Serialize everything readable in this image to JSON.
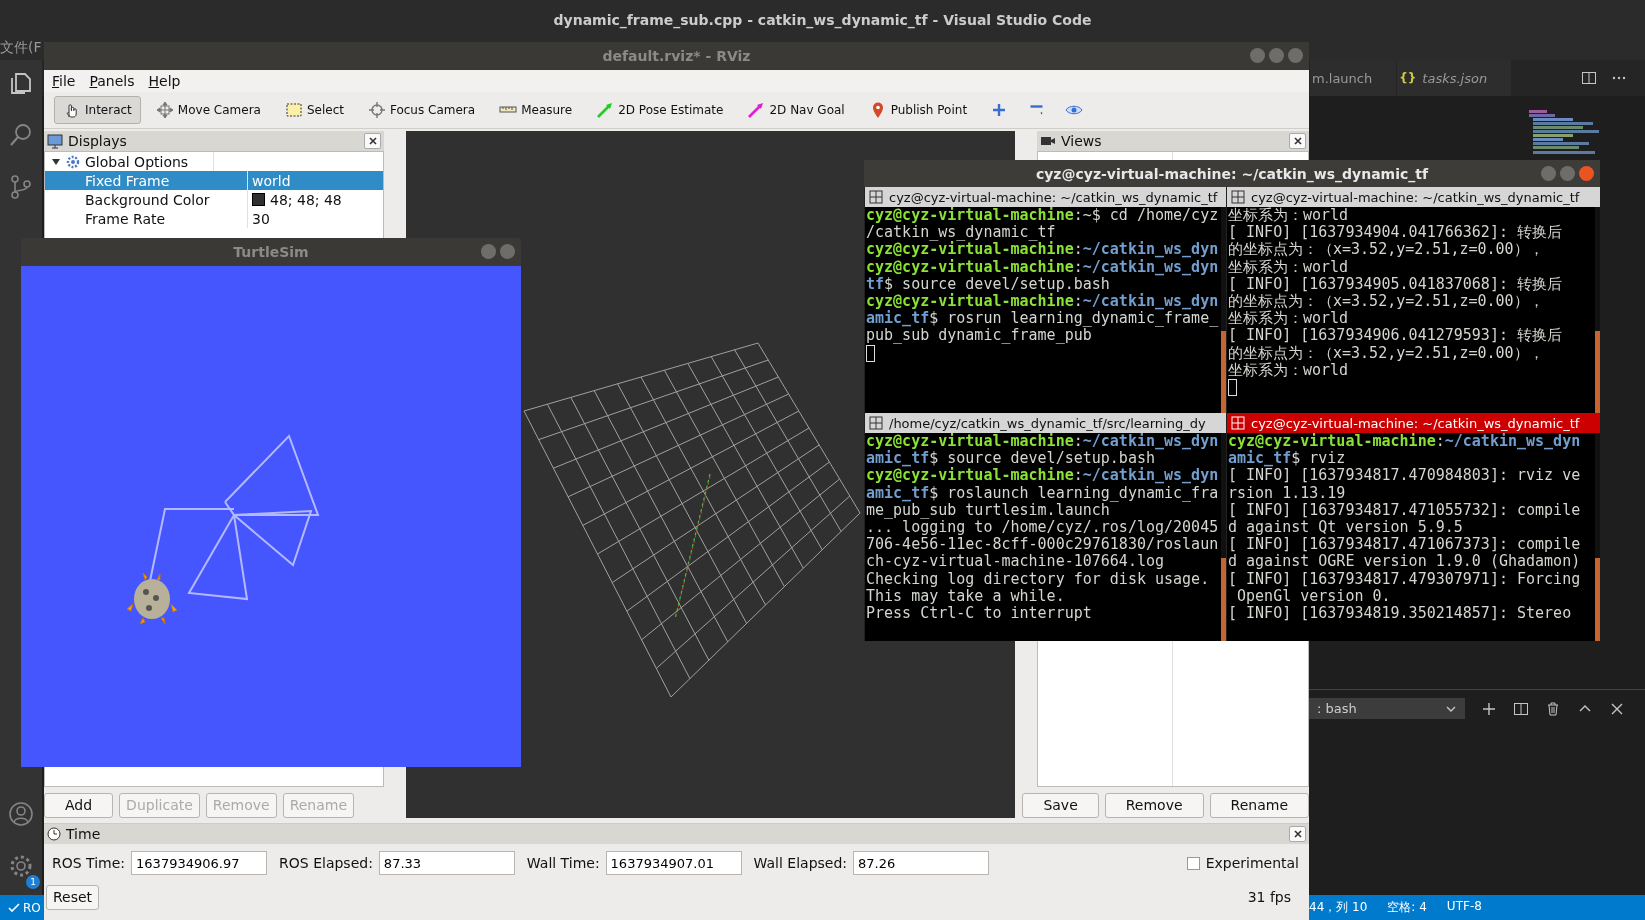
{
  "vscode": {
    "title": "dynamic_frame_sub.cpp - catkin_ws_dynamic_tf - Visual Studio Code",
    "menu_fragment": "文件(F",
    "tabs": [
      {
        "label": "m.launch",
        "kind": "plain"
      },
      {
        "label": "tasks.json",
        "kind": "preview",
        "glyph": "{}"
      }
    ],
    "terminal_dropdown": ": bash",
    "settings_badge": "1",
    "status_left": "RO",
    "status_right": [
      "44，列 10",
      "空格: 4",
      "UTF-8"
    ]
  },
  "rviz": {
    "title": "default.rviz* - RViz",
    "menu": [
      "File",
      "Panels",
      "Help"
    ],
    "tools": [
      {
        "label": "Interact",
        "kind": "hand",
        "selected": true
      },
      {
        "label": "Move Camera",
        "kind": "move",
        "selected": false
      },
      {
        "label": "Select",
        "kind": "select",
        "selected": false
      },
      {
        "label": "Focus Camera",
        "kind": "focus",
        "selected": false
      },
      {
        "label": "Measure",
        "kind": "ruler",
        "selected": false
      },
      {
        "label": "2D Pose Estimate",
        "kind": "pose",
        "selected": false
      },
      {
        "label": "2D Nav Goal",
        "kind": "goal",
        "selected": false
      },
      {
        "label": "Publish Point",
        "kind": "pin",
        "selected": false
      },
      {
        "kind": "plus",
        "selected": false
      },
      {
        "kind": "minus",
        "selected": false
      },
      {
        "kind": "eye",
        "selected": false
      }
    ],
    "displays": {
      "title": "Displays",
      "tree": [
        {
          "name": "Global Options",
          "expanded": true,
          "children": [
            {
              "name": "Fixed Frame",
              "value": "world",
              "selected": true
            },
            {
              "name": "Background Color",
              "value": "48; 48; 48",
              "color": "#303030",
              "selected": false
            },
            {
              "name": "Frame Rate",
              "value": "30",
              "selected": false
            }
          ]
        }
      ],
      "buttons": [
        {
          "label": "Add",
          "disabled": false
        },
        {
          "label": "Duplicate",
          "disabled": true
        },
        {
          "label": "Remove",
          "disabled": true
        },
        {
          "label": "Rename",
          "disabled": true
        }
      ]
    },
    "views": {
      "title": "Views",
      "buttons": [
        "Save",
        "Remove",
        "Rename"
      ]
    },
    "time": {
      "title": "Time",
      "fields": [
        {
          "label": "ROS Time:",
          "value": "1637934906.97"
        },
        {
          "label": "ROS Elapsed:",
          "value": "87.33"
        },
        {
          "label": "Wall Time:",
          "value": "1637934907.01"
        },
        {
          "label": "Wall Elapsed:",
          "value": "87.26"
        }
      ],
      "experimental": {
        "label": "Experimental",
        "checked": false
      },
      "reset": "Reset",
      "fps": "31 fps"
    }
  },
  "turtlesim": {
    "title": "TurtleSim"
  },
  "terminal": {
    "title": "cyz@cyz-virtual-machine: ~/catkin_ws_dynamic_tf",
    "panes": [
      {
        "tab": "cyz@cyz-virtual-machine: ~/catkin_ws_dynamic_tf",
        "active": false,
        "cursor": true,
        "lines": [
          [
            {
              "kind": "user",
              "text": "cyz@cyz-virtual-machine"
            },
            {
              "kind": "text",
              "text": ":~$ cd /home/cyz"
            }
          ],
          [
            {
              "kind": "text",
              "text": "/catkin_ws_dynamic_tf"
            }
          ],
          [
            {
              "kind": "user",
              "text": "cyz@cyz-virtual-machine"
            },
            {
              "kind": "text",
              "text": ":"
            },
            {
              "kind": "path",
              "text": "~/catkin_ws_dyn"
            }
          ],
          [
            {
              "kind": "user",
              "text": "cyz@cyz-virtual-machine"
            },
            {
              "kind": "text",
              "text": ":"
            },
            {
              "kind": "path",
              "text": "~/catkin_ws_dyn"
            }
          ],
          [
            {
              "kind": "path",
              "text": "tf"
            },
            {
              "kind": "text",
              "text": "$ source devel/setup.bash"
            }
          ],
          [
            {
              "kind": "user",
              "text": "cyz@cyz-virtual-machine"
            },
            {
              "kind": "text",
              "text": ":"
            },
            {
              "kind": "path",
              "text": "~/catkin_ws_dyn"
            }
          ],
          [
            {
              "kind": "path",
              "text": "amic_tf"
            },
            {
              "kind": "text",
              "text": "$ rosrun learning_dynamic_frame_"
            }
          ],
          [
            {
              "kind": "text",
              "text": "pub_sub dynamic_frame_pub"
            }
          ]
        ]
      },
      {
        "tab": "cyz@cyz-virtual-machine: ~/catkin_ws_dynamic_tf",
        "active": false,
        "cursor": true,
        "lines": [
          [
            {
              "kind": "text",
              "text": "坐标系为：world"
            }
          ],
          [
            {
              "kind": "text",
              "text": "[ INFO] [1637934904.041766362]: 转换后"
            }
          ],
          [
            {
              "kind": "text",
              "text": "的坐标点为：（x=3.52,y=2.51,z=0.00），"
            }
          ],
          [
            {
              "kind": "text",
              "text": "坐标系为：world"
            }
          ],
          [
            {
              "kind": "text",
              "text": "[ INFO] [1637934905.041837068]: 转换后"
            }
          ],
          [
            {
              "kind": "text",
              "text": "的坐标点为：（x=3.52,y=2.51,z=0.00），"
            }
          ],
          [
            {
              "kind": "text",
              "text": "坐标系为：world"
            }
          ],
          [
            {
              "kind": "text",
              "text": "[ INFO] [1637934906.041279593]: 转换后"
            }
          ],
          [
            {
              "kind": "text",
              "text": "的坐标点为：（x=3.52,y=2.51,z=0.00），"
            }
          ],
          [
            {
              "kind": "text",
              "text": "坐标系为：world"
            }
          ]
        ]
      },
      {
        "tab": "/home/cyz/catkin_ws_dynamic_tf/src/learning_dy",
        "active": false,
        "cursor": false,
        "lines": [
          [
            {
              "kind": "user",
              "text": "cyz@cyz-virtual-machine"
            },
            {
              "kind": "text",
              "text": ":"
            },
            {
              "kind": "path",
              "text": "~/catkin_ws_dyn"
            }
          ],
          [
            {
              "kind": "path",
              "text": "amic_tf"
            },
            {
              "kind": "text",
              "text": "$ source devel/setup.bash"
            }
          ],
          [
            {
              "kind": "user",
              "text": "cyz@cyz-virtual-machine"
            },
            {
              "kind": "text",
              "text": ":"
            },
            {
              "kind": "path",
              "text": "~/catkin_ws_dyn"
            }
          ],
          [
            {
              "kind": "path",
              "text": "amic_tf"
            },
            {
              "kind": "text",
              "text": "$ roslaunch learning_dynamic_fra"
            }
          ],
          [
            {
              "kind": "text",
              "text": "me_pub_sub turtlesim.launch"
            }
          ],
          [
            {
              "kind": "text",
              "text": "... logging to /home/cyz/.ros/log/20045"
            }
          ],
          [
            {
              "kind": "text",
              "text": "706-4e56-11ec-8cff-000c29761830/roslaun"
            }
          ],
          [
            {
              "kind": "text",
              "text": "ch-cyz-virtual-machine-107664.log"
            }
          ],
          [
            {
              "kind": "text",
              "text": "Checking log directory for disk usage."
            }
          ],
          [
            {
              "kind": "text",
              "text": "This may take a while."
            }
          ],
          [
            {
              "kind": "text",
              "text": "Press Ctrl-C to interrupt"
            }
          ]
        ]
      },
      {
        "tab": "cyz@cyz-virtual-machine: ~/catkin_ws_dynamic_tf",
        "active": true,
        "cursor": false,
        "lines": [
          [
            {
              "kind": "user",
              "text": "cyz@cyz-virtual-machine"
            },
            {
              "kind": "text",
              "text": ":"
            },
            {
              "kind": "path",
              "text": "~/catkin_ws_dyn"
            }
          ],
          [
            {
              "kind": "path",
              "text": "amic_tf"
            },
            {
              "kind": "text",
              "text": "$ rviz"
            }
          ],
          [
            {
              "kind": "text",
              "text": "[ INFO] [1637934817.470984803]: rviz ve"
            }
          ],
          [
            {
              "kind": "text",
              "text": "rsion 1.13.19"
            }
          ],
          [
            {
              "kind": "text",
              "text": "[ INFO] [1637934817.471055732]: compile"
            }
          ],
          [
            {
              "kind": "text",
              "text": "d against Qt version 5.9.5"
            }
          ],
          [
            {
              "kind": "text",
              "text": "[ INFO] [1637934817.471067373]: compile"
            }
          ],
          [
            {
              "kind": "text",
              "text": "d against OGRE version 1.9.0 (Ghadamon)"
            }
          ],
          [
            {
              "kind": "text",
              "text": "[ INFO] [1637934817.479307971]: Forcing"
            }
          ],
          [
            {
              "kind": "text",
              "text": " OpenGl version 0."
            }
          ],
          [
            {
              "kind": "text",
              "text": "[ INFO] [1637934819.350214857]: Stereo"
            }
          ]
        ]
      }
    ]
  }
}
